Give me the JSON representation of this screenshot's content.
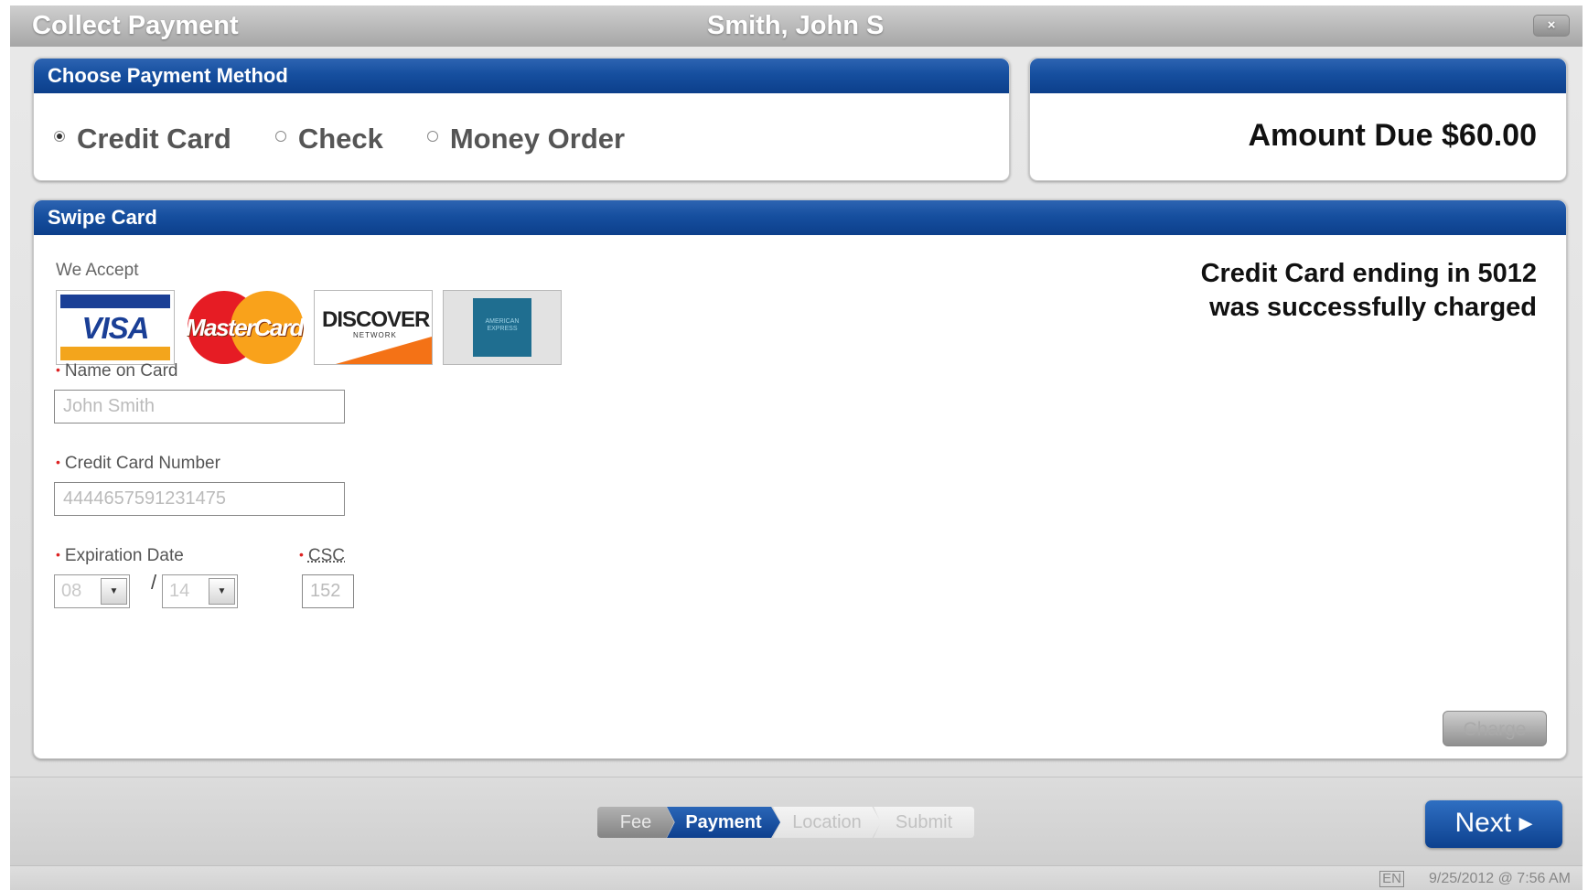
{
  "window": {
    "title": "Collect Payment",
    "patient_name": "Smith, John S",
    "close_label": "×"
  },
  "payment_method": {
    "header": "Choose Payment Method",
    "options": [
      {
        "label": "Credit Card",
        "selected": true
      },
      {
        "label": "Check",
        "selected": false
      },
      {
        "label": "Money Order",
        "selected": false
      }
    ]
  },
  "amount": {
    "header": "",
    "text": "Amount Due $60.00"
  },
  "swipe": {
    "header": "Swipe Card",
    "we_accept": "We Accept",
    "cards": [
      {
        "name": "VISA",
        "icon": "visa-logo"
      },
      {
        "name": "MasterCard",
        "icon": "mastercard-logo"
      },
      {
        "name": "DISCOVER",
        "icon": "discover-logo"
      },
      {
        "name": "AMERICAN EXPRESS",
        "icon": "amex-logo"
      }
    ],
    "discover_sub": "NETWORK",
    "success_line1": "Credit Card ending in 5012",
    "success_line2": "was successfully charged",
    "name_label": "Name on Card",
    "name_value": "John Smith",
    "number_label": "Credit Card Number",
    "number_value": "4444657591231475",
    "exp_label": "Expiration Date",
    "exp_month": "08",
    "exp_year": "14",
    "exp_separator": "/",
    "csc_label": "CSC",
    "csc_value": "152",
    "required_marker": "•",
    "charge_label": "Charge"
  },
  "footer": {
    "steps": [
      "Fee",
      "Payment",
      "Location",
      "Submit"
    ],
    "active_step": "Payment",
    "next_label": "Next ▸"
  },
  "status_bar": {
    "language": "EN",
    "datetime": "9/25/2012 @ 7:56 AM"
  },
  "colors": {
    "header_blue": "#164f9f",
    "required_red": "#dd2222"
  }
}
